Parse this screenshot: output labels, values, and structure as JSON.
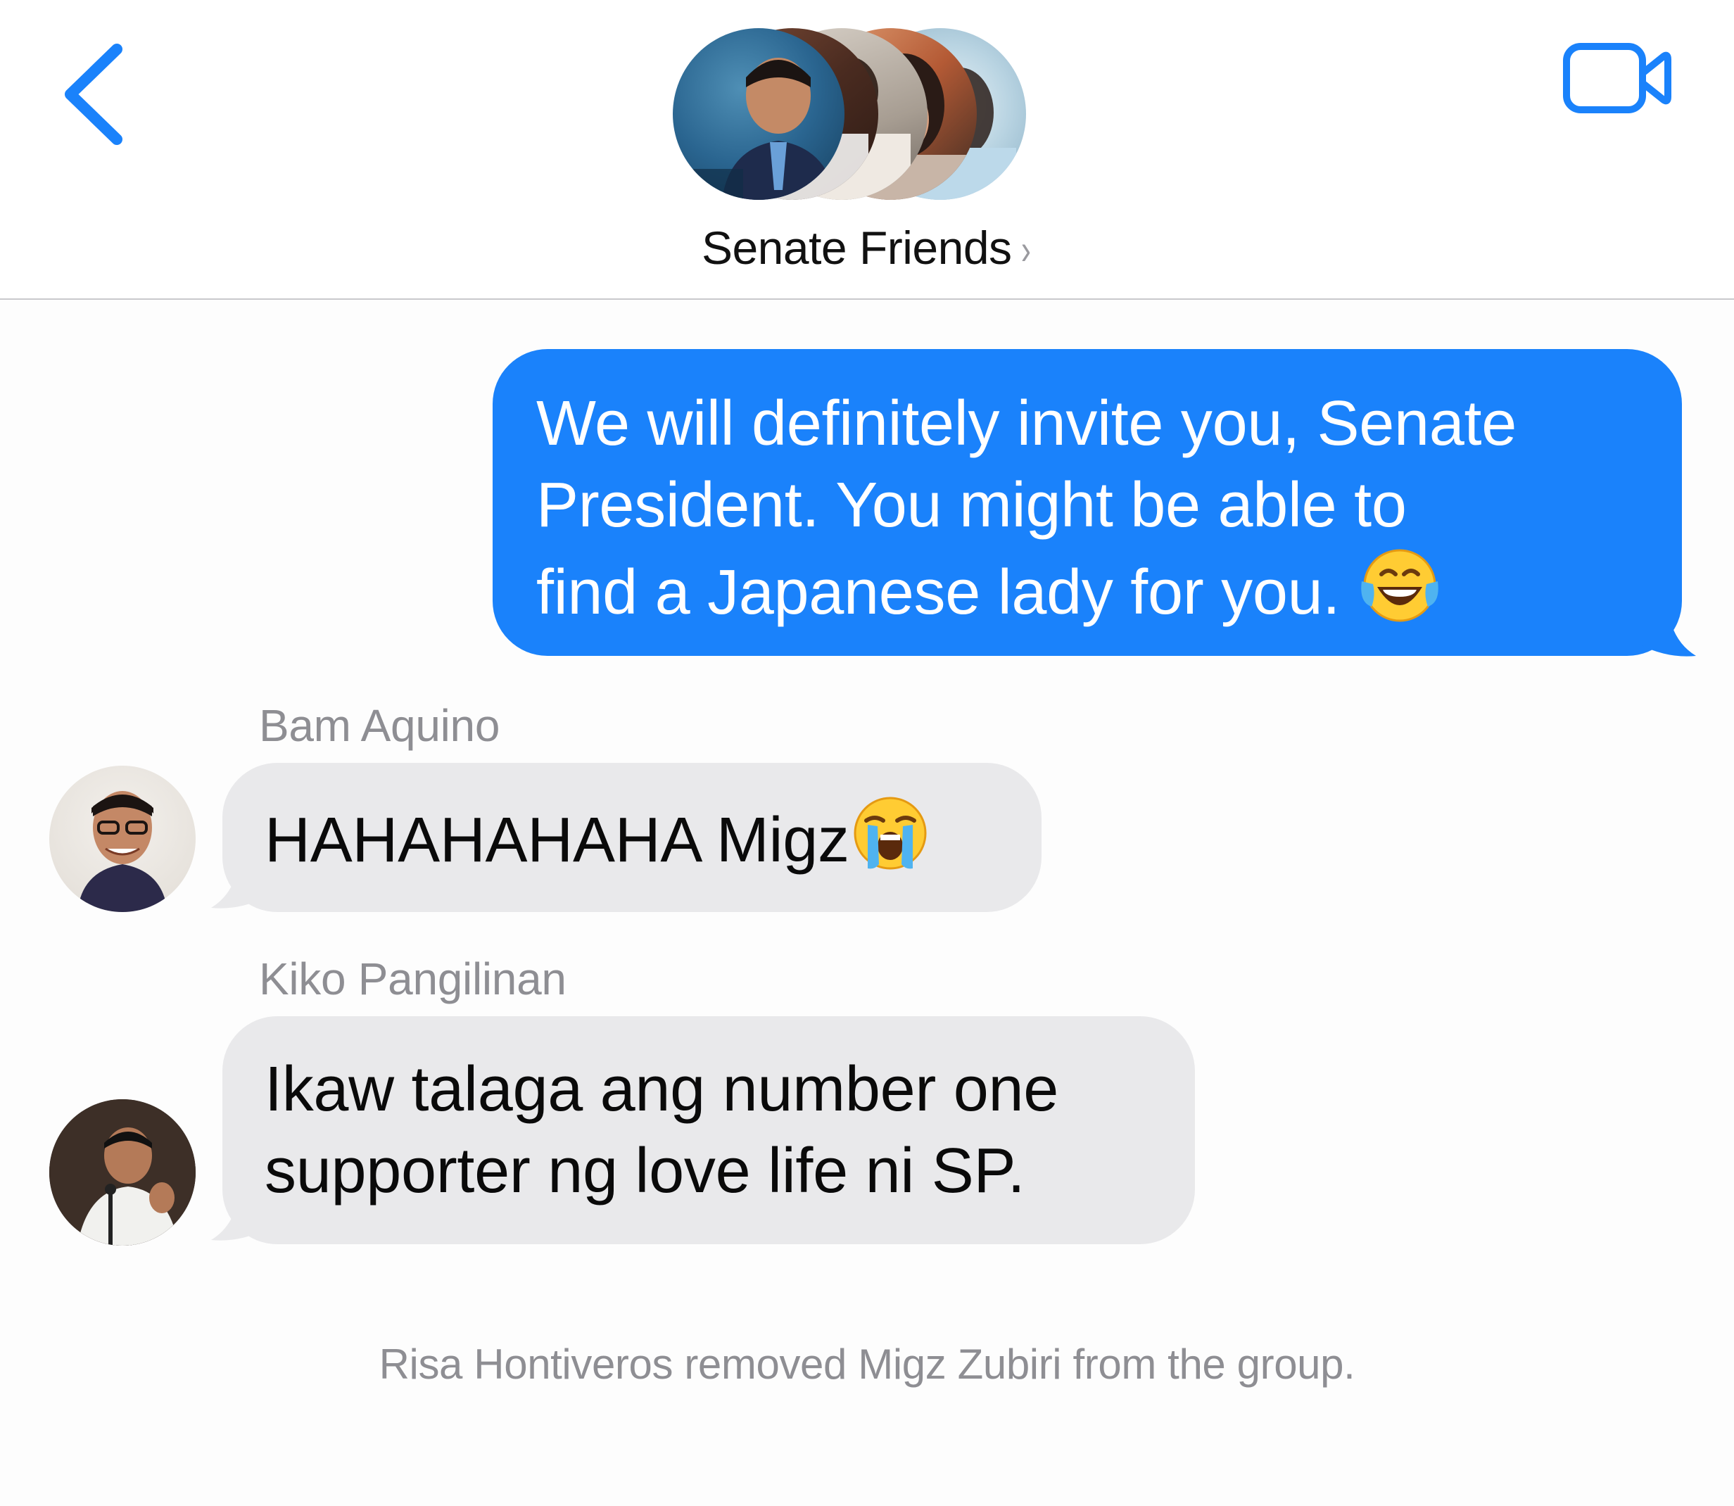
{
  "header": {
    "group_name": "Senate Friends",
    "chevron": "›"
  },
  "colors": {
    "accent": "#1a82fb",
    "incoming_bubble": "#e9e9eb",
    "secondary_text": "#8e8e93"
  },
  "messages": [
    {
      "direction": "outgoing",
      "lines": [
        "We will definitely invite you, Senate",
        "President. You might be able to",
        "find a Japanese lady for you."
      ],
      "emoji": "face-with-tears-of-joy"
    },
    {
      "direction": "incoming",
      "sender": "Bam Aquino",
      "lines": [
        "HAHAHAHAHA Migz"
      ],
      "emoji": "loudly-crying-face"
    },
    {
      "direction": "incoming",
      "sender": "Kiko Pangilinan",
      "lines": [
        "Ikaw talaga ang number one",
        "supporter ng love life ni SP."
      ]
    }
  ],
  "system_message": "Risa Hontiveros removed Migz Zubiri from the group."
}
